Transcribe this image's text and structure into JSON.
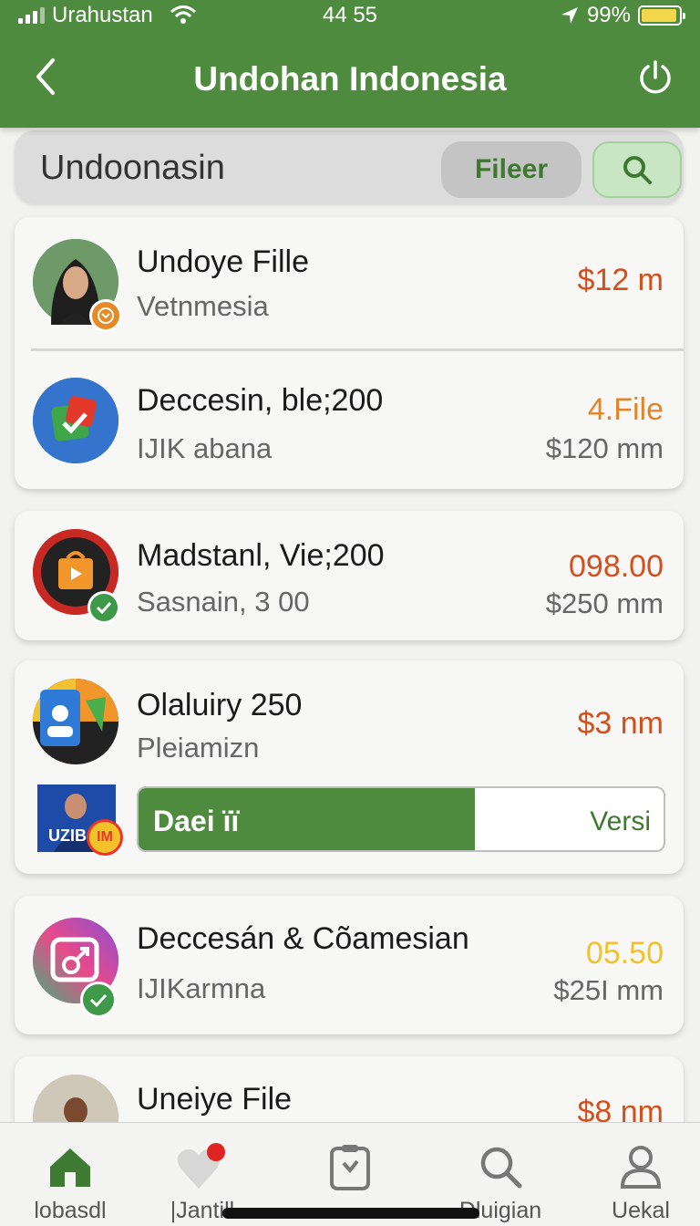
{
  "status_bar": {
    "carrier": "Urahustan",
    "time": "44 55",
    "battery": "99%",
    "battery_level": 0.95
  },
  "header": {
    "title": "Undohan Indonesia",
    "back_icon": "chevron-left-icon",
    "power_icon": "power-icon"
  },
  "search": {
    "text": "Undoonasin",
    "filter_label": "Fileer",
    "search_icon": "search-icon"
  },
  "colors": {
    "primary": "#4e8b3f",
    "price_red": "#d2501c",
    "price_orange": "#e0852a",
    "price_yellow": "#efc22e"
  },
  "items": [
    {
      "name": "Undoye Fille",
      "sub": "Vetnmesia",
      "price": "$12 m",
      "price2": ""
    },
    {
      "name": "Deccesin, ble;200",
      "sub": "IJIK abana",
      "price": "4.File",
      "price2": "$120 mm"
    },
    {
      "name": "Madstanl, Vie;200",
      "sub": "Sasnain, 3 00",
      "price": "098.00",
      "price2": "$250 mm"
    },
    {
      "name": "Olaluiry 250",
      "sub": "Pleiamizn",
      "price": "$3 nm",
      "price2": ""
    },
    {
      "name": "Deccesán & Cõamesian",
      "sub": "IJIKarmna",
      "price": "05.50",
      "price2": "$25I mm"
    },
    {
      "name": "Uneiye File",
      "sub": "",
      "price": "$8 nm",
      "price2": ""
    }
  ],
  "progress": {
    "label": "Daei ïï",
    "right_label": "Versi",
    "value": 0.64
  },
  "thumb": {
    "text": "UZIB",
    "badge": "IM"
  },
  "nav": [
    {
      "label": "lobasdl",
      "icon": "home-icon"
    },
    {
      "label": "|Jantill",
      "icon": "heart-icon"
    },
    {
      "label": "",
      "icon": "clipboard-icon"
    },
    {
      "label": "Dluigian",
      "icon": "search-icon"
    },
    {
      "label": "Uekal",
      "icon": "user-icon"
    }
  ]
}
